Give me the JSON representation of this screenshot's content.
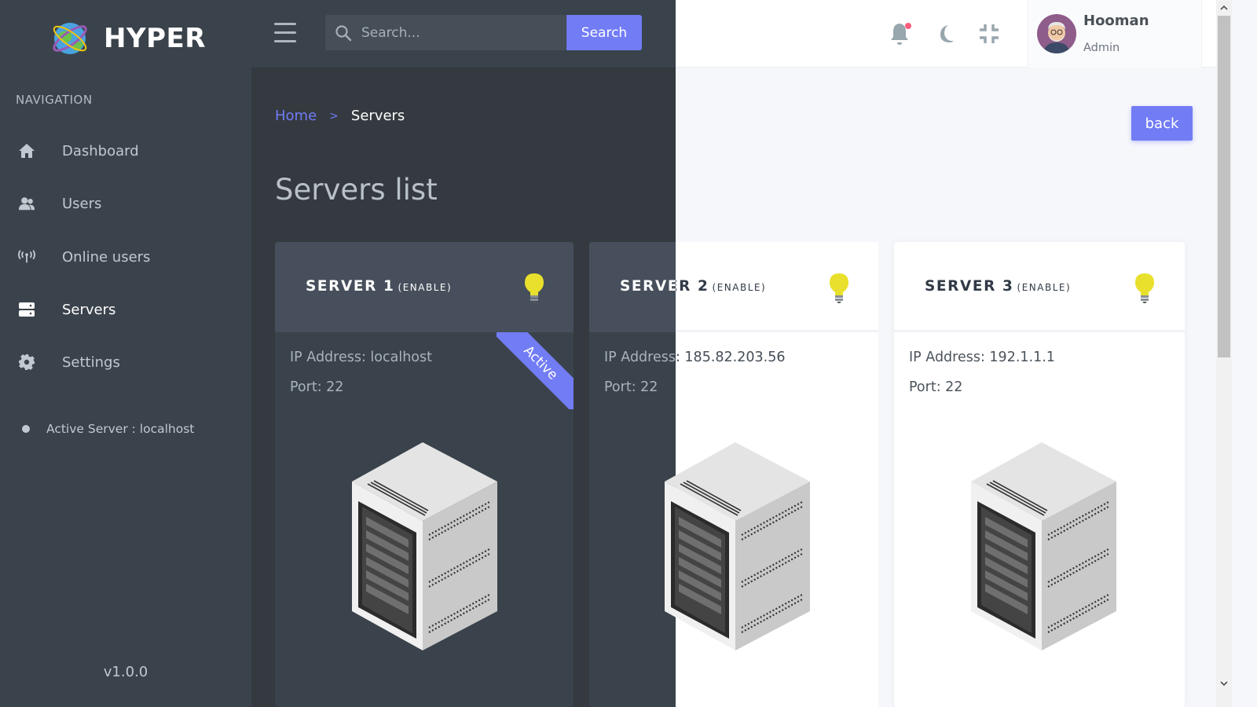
{
  "brand": {
    "name": "HYPER"
  },
  "sidebar": {
    "heading": "NAVIGATION",
    "items": [
      {
        "label": "Dashboard",
        "icon": "home-icon"
      },
      {
        "label": "Users",
        "icon": "users-icon"
      },
      {
        "label": "Online users",
        "icon": "broadcast-icon"
      },
      {
        "label": "Servers",
        "icon": "server-icon",
        "active": true
      },
      {
        "label": "Settings",
        "icon": "gear-icon"
      }
    ],
    "active_server": "Active Server : localhost",
    "version": "v1.0.0"
  },
  "topbar": {
    "search_placeholder": "Search...",
    "search_button": "Search",
    "user": {
      "name": "Hooman",
      "role": "Admin"
    }
  },
  "breadcrumb": {
    "home": "Home",
    "separator": ">",
    "current": "Servers"
  },
  "back_button": "back",
  "page_title": "Servers list",
  "servers": [
    {
      "name": "SERVER 1",
      "status": "(ENABLE)",
      "ip": "IP Address: localhost",
      "port": "Port: 22",
      "ribbon": "Active"
    },
    {
      "name": "SERVER 2",
      "status": "(ENABLE)",
      "ip": "IP Address: 185.82.203.56",
      "port": "Port: 22"
    },
    {
      "name": "SERVER 3",
      "status": "(ENABLE)",
      "ip": "IP Address: 192.1.1.1",
      "port": "Port: 22"
    }
  ],
  "colors": {
    "accent": "#727cf5",
    "sidebar_bg": "#3a434b",
    "dark_bg": "#343a40",
    "notification_dot": "#fa5c7c",
    "bulb": "#e8e02c"
  }
}
